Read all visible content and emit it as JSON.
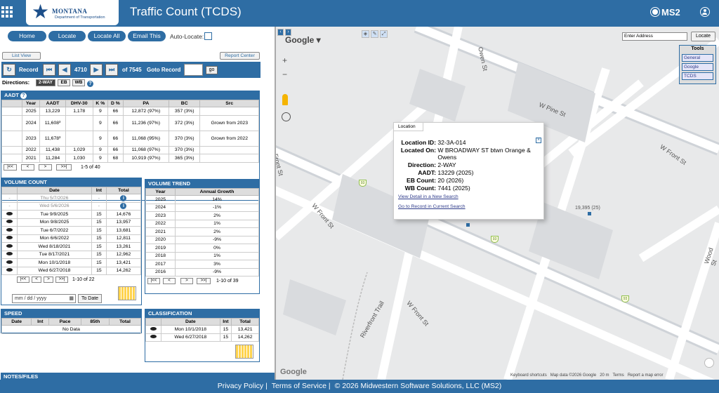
{
  "app_title": "Traffic Count (TCDS)",
  "logo": {
    "name": "MONTANA",
    "dept": "Department of Transportation"
  },
  "brand": "MS2",
  "nav": {
    "home": "Home",
    "locate": "Locate",
    "locate_all": "Locate All",
    "email": "Email This",
    "auto_locate": "Auto-Locate:"
  },
  "links": {
    "list_view": "List View",
    "report_center": "Report Center"
  },
  "record": {
    "label": "Record",
    "current": "4710",
    "of_total": "of 7545",
    "goto_label": "Goto Record",
    "go": "go"
  },
  "directions": {
    "label": "Directions:",
    "options": [
      "2-WAY",
      "EB",
      "WB"
    ]
  },
  "aadt": {
    "title": "AADT",
    "headers": [
      "Year",
      "AADT",
      "DHV-30",
      "K %",
      "D %",
      "PA",
      "BC",
      "Src"
    ],
    "rows": [
      [
        "2025",
        "13,229",
        "1,178",
        "9",
        "66",
        "12,872 (97%)",
        "357 (3%)",
        ""
      ],
      [
        "2024",
        "11,608³",
        "",
        "9",
        "66",
        "11,236 (97%)",
        "372 (3%)",
        "Grown from 2023"
      ],
      [
        "2023",
        "11,678³",
        "",
        "9",
        "66",
        "11,068 (95%)",
        "370 (3%)",
        "Grown from 2022"
      ],
      [
        "2022",
        "11,438",
        "1,029",
        "9",
        "66",
        "11,068 (97%)",
        "370 (3%)",
        ""
      ],
      [
        "2021",
        "11,284",
        "1,030",
        "9",
        "68",
        "10,919 (97%)",
        "365 (3%)",
        ""
      ]
    ],
    "pager_text": "1-5 of 40"
  },
  "volume_count": {
    "title": "VOLUME COUNT",
    "headers": [
      "Date",
      "Int",
      "Total"
    ],
    "rows": [
      [
        "Thu 5/7/2026",
        "-",
        ""
      ],
      [
        "Wed 5/6/2026",
        "-",
        ""
      ],
      [
        "Tue 9/9/2025",
        "15",
        "14,676"
      ],
      [
        "Mon 9/8/2025",
        "15",
        "13,957"
      ],
      [
        "Tue 6/7/2022",
        "15",
        "13,681"
      ],
      [
        "Mon 6/6/2022",
        "15",
        "12,811"
      ],
      [
        "Wed 8/18/2021",
        "15",
        "13,261"
      ],
      [
        "Tue 8/17/2021",
        "15",
        "12,962"
      ],
      [
        "Mon 10/1/2018",
        "15",
        "13,421"
      ],
      [
        "Wed 6/27/2018",
        "15",
        "14,262"
      ]
    ],
    "pager_text": "1-10 of 22",
    "date_placeholder": "mm / dd / yyyy",
    "to_date": "To Date"
  },
  "volume_trend": {
    "title": "VOLUME TREND",
    "headers": [
      "Year",
      "Annual Growth"
    ],
    "rows": [
      [
        "2025",
        "14%"
      ],
      [
        "2024",
        "-1%"
      ],
      [
        "2023",
        "2%"
      ],
      [
        "2022",
        "1%"
      ],
      [
        "2021",
        "2%"
      ],
      [
        "2020",
        "-9%"
      ],
      [
        "2019",
        "0%"
      ],
      [
        "2018",
        "1%"
      ],
      [
        "2017",
        "3%"
      ],
      [
        "2016",
        "-9%"
      ]
    ],
    "pager_text": "1-10 of 39"
  },
  "speed": {
    "title": "SPEED",
    "headers": [
      "Date",
      "Int",
      "Pace",
      "85th",
      "Total"
    ],
    "empty": "No Data"
  },
  "classification": {
    "title": "CLASSIFICATION",
    "headers": [
      "Date",
      "Int",
      "Total"
    ],
    "rows": [
      [
        "Mon 10/1/2018",
        "15",
        "13,421"
      ],
      [
        "Wed 6/27/2018",
        "15",
        "14,262"
      ]
    ]
  },
  "notes_title": "NOTES/FILES",
  "map": {
    "google": "Google",
    "address_placeholder": "Enter Address",
    "locate": "Locate",
    "tools": {
      "title": "Tools",
      "items": [
        "General",
        "Google",
        "TCDS"
      ]
    },
    "streets": [
      "Owen St",
      "W Pine St",
      "W Front St",
      "W Front St",
      "W Front St",
      "Riverfront Trail",
      "Front St",
      "Wood St"
    ],
    "station_label": "19,395 (25)",
    "shield": "93",
    "attribution": [
      "Keyboard shortcuts",
      "Map data ©2026 Google",
      "20 m",
      "Terms",
      "Report a map error"
    ],
    "popup": {
      "tab": "Location",
      "fields": [
        {
          "label": "Location ID:",
          "value": "32-3A-014"
        },
        {
          "label": "Located On:",
          "value": "W BROADWAY ST btwn Orange & Owens"
        },
        {
          "label": "Direction:",
          "value": "2-WAY"
        },
        {
          "label": "AADT:",
          "value": "13229 (2025)"
        },
        {
          "label": "EB Count:",
          "value": "20 (2026)"
        },
        {
          "label": "WB Count:",
          "value": "7441 (2025)"
        }
      ],
      "links": [
        "View Detail in a New Search",
        "Go to Record in Current Search"
      ]
    }
  },
  "footer": {
    "privacy": "Privacy Policy",
    "terms": "Terms of Service",
    "copyright": "© 2026 Midwestern Software Solutions, LLC (MS2)"
  }
}
